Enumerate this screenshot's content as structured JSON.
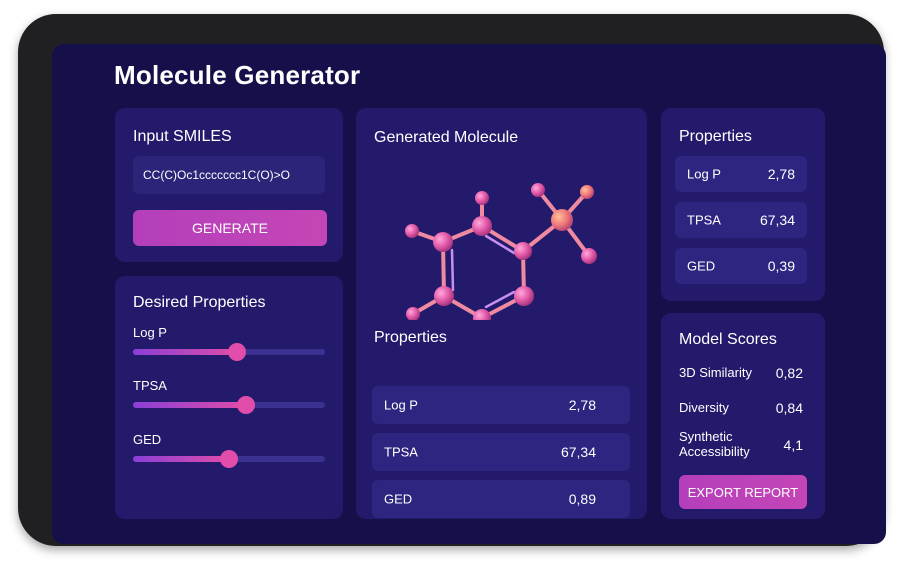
{
  "app": {
    "title": "Molecule Generator"
  },
  "input": {
    "title": "Input SMILES",
    "smiles": "CC(C)Oc1ccccccc1C(O)>O",
    "generate_label": "GENERATE"
  },
  "desired": {
    "title": "Desired Properties",
    "sliders": [
      {
        "label": "Log P",
        "value": 0.54
      },
      {
        "label": "TPSA",
        "value": 0.59
      },
      {
        "label": "GED",
        "value": 0.5
      }
    ]
  },
  "generated": {
    "title": "Generated Molecule",
    "properties_title": "Properties",
    "properties": [
      {
        "label": "Log P",
        "value": "2,78"
      },
      {
        "label": "TPSA",
        "value": "67,34"
      },
      {
        "label": "GED",
        "value": "0,89"
      }
    ]
  },
  "properties": {
    "title": "Properties",
    "items": [
      {
        "label": "Log P",
        "value": "2,78"
      },
      {
        "label": "TPSA",
        "value": "67,34"
      },
      {
        "label": "GED",
        "value": "0,39"
      }
    ]
  },
  "scores": {
    "title": "Model Scores",
    "items": [
      {
        "label": "3D Similarity",
        "value": "0,82"
      },
      {
        "label": "Diversity",
        "value": "0,84"
      },
      {
        "label": "Synthetic\nAccessibility",
        "value": "4,1"
      }
    ],
    "export_label": "EXPORT REPORT"
  },
  "colors": {
    "background": "#16104a",
    "panel": "#231a6b",
    "accent": "#c446b6",
    "atom": "#e25aa8"
  }
}
